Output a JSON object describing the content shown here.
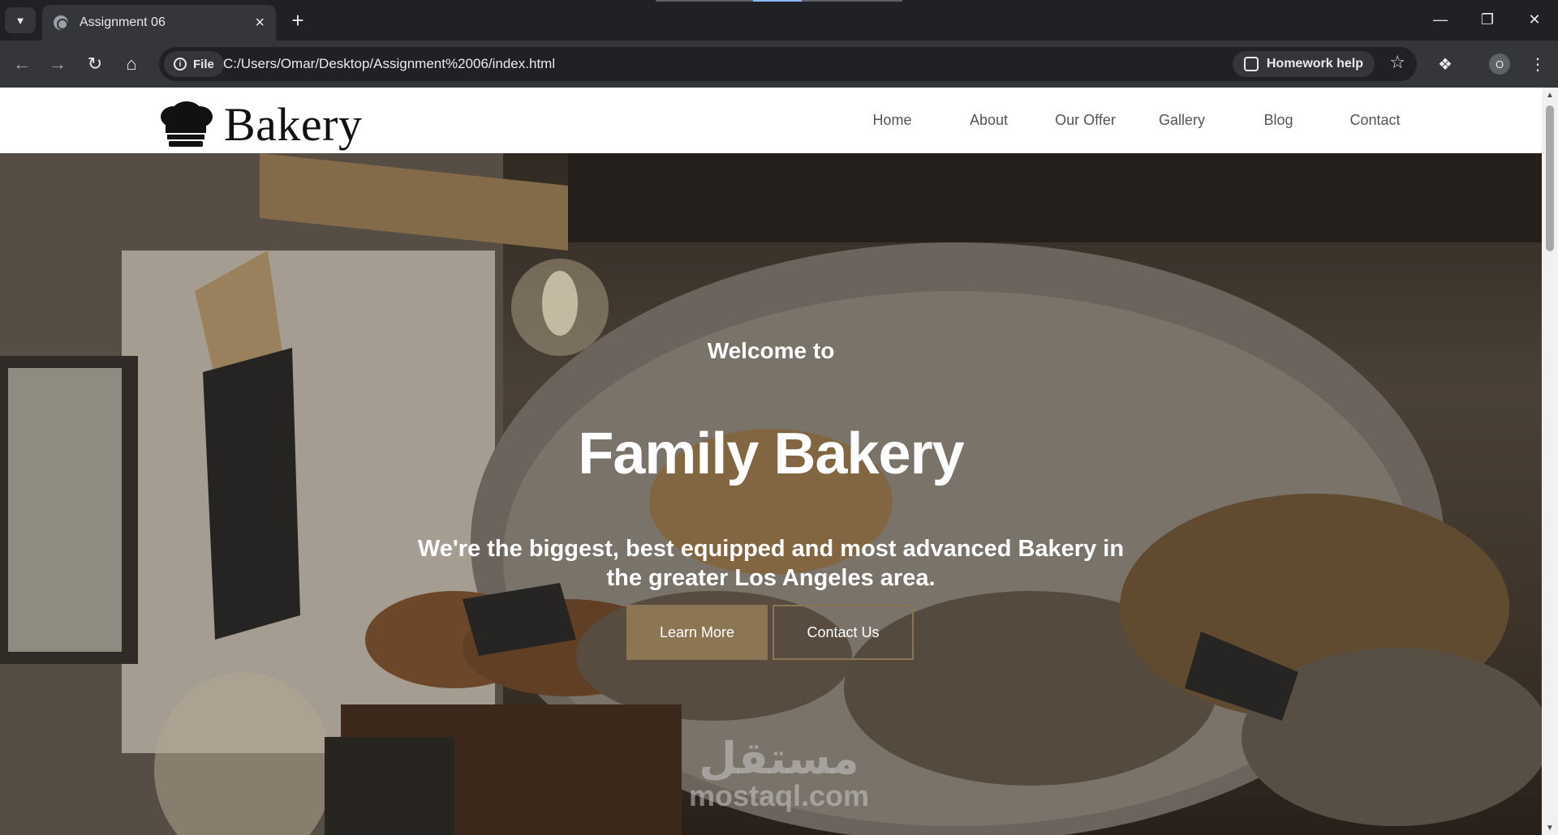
{
  "browser": {
    "tab_title": "Assignment 06",
    "file_chip": "File",
    "url": "C:/Users/Omar/Desktop/Assignment%2006/index.html",
    "homework_help": "Homework help",
    "profile_initial": "O"
  },
  "site": {
    "logo_text": "Bakery",
    "nav": [
      "Home",
      "About",
      "Our Offer",
      "Gallery",
      "Blog",
      "Contact"
    ],
    "hero": {
      "welcome": "Welcome to",
      "title": "Family Bakery",
      "subtitle": "We're the biggest, best equipped and most advanced Bakery in the greater Los Angeles area.",
      "primary_button": "Learn More",
      "secondary_button": "Contact Us"
    },
    "accent_color": "#8b7552"
  },
  "watermark": {
    "arabic": "مستقل",
    "latin": "mostaql.com"
  }
}
